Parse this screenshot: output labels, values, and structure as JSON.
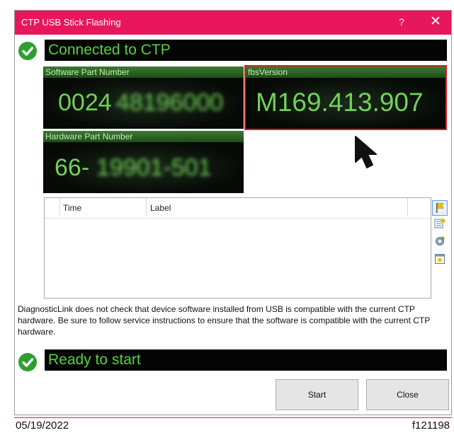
{
  "window": {
    "title": "CTP USB Stick Flashing",
    "help_label": "?",
    "close_label": "✕"
  },
  "status_top": {
    "text": "Connected to CTP",
    "icon": "check-circle-icon"
  },
  "software_part": {
    "label": "Software Part Number",
    "visible_value": "0024",
    "obscured_value": "48196000"
  },
  "fbs_version": {
    "label": "fbsVersion",
    "value": "M169.413.907"
  },
  "hardware_part": {
    "label": "Hardware Part Number",
    "visible_value": "66-",
    "obscured_value": "19901-501"
  },
  "log_table": {
    "columns": [
      "Time",
      "Label"
    ],
    "rows": []
  },
  "side_toolbar": [
    "flag-icon",
    "export-icon",
    "settings-icon",
    "notes-icon"
  ],
  "notice": "DiagnosticLink does not check that device software installed from USB is compatible with the current CTP hardware. Be sure to follow service instructions to ensure that the software is compatible with the current CTP hardware.",
  "status_bottom": {
    "text": "Ready to start",
    "icon": "check-circle-icon"
  },
  "buttons": {
    "start": "Start",
    "close": "Close"
  },
  "footer": {
    "date": "05/19/2022",
    "figure_id": "f121198"
  },
  "colors": {
    "titlebar": "#e8175d",
    "status_text": "#53d13c",
    "highlight": "#e01f1f",
    "panel_header": "#2e6627"
  }
}
